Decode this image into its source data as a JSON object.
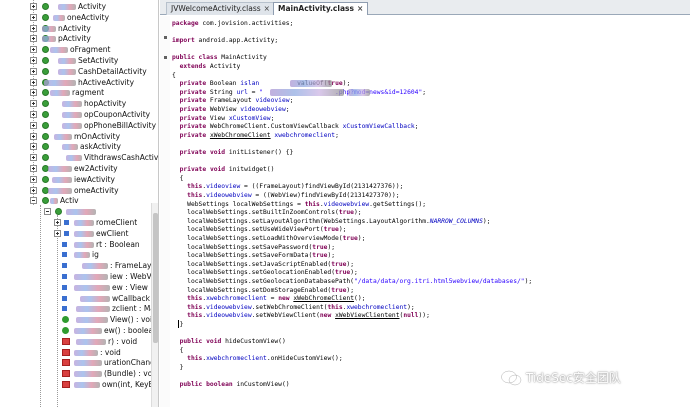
{
  "tree": {
    "items": [
      {
        "label": "Activity"
      },
      {
        "label": "oneActivity"
      },
      {
        "label": "nActivity"
      },
      {
        "label": "pActivity"
      },
      {
        "label": "oFragment"
      },
      {
        "label": "SetActivity"
      },
      {
        "label": "CashDetailActivity"
      },
      {
        "label": "hActiveActivity"
      },
      {
        "label": "ragment"
      },
      {
        "label": "hopActivity"
      },
      {
        "label": "opCouponActivity"
      },
      {
        "label": "opPhoneBillActivity"
      },
      {
        "label": "mOnActivity"
      },
      {
        "label": "askActivity"
      },
      {
        "label": "VithdrawsCashActivity"
      },
      {
        "label": "ew2Activity"
      },
      {
        "label": "iewActivity"
      },
      {
        "label": "omeActivity"
      },
      {
        "label": "Activ"
      }
    ],
    "members": [
      {
        "label": ""
      },
      {
        "label": "romeClient"
      },
      {
        "label": "ewClient"
      },
      {
        "label": "rt : Boolean"
      },
      {
        "label": "ig"
      },
      {
        "label": ": FrameLayout"
      },
      {
        "label": "iew : WebView"
      },
      {
        "label": "ew : View"
      },
      {
        "label": "wCallback : \\"
      },
      {
        "label": "zclient : Mair"
      },
      {
        "label": "View() : void"
      },
      {
        "label": "ew() : boolea"
      },
      {
        "label": "r) : void"
      },
      {
        "label": ": void"
      },
      {
        "label": "urationChange("
      },
      {
        "label": "(Bundle) : void"
      },
      {
        "label": "own(int, KeyEven"
      }
    ]
  },
  "tabs": [
    {
      "label": "JVWelcomeActivity.class",
      "active": false
    },
    {
      "label": "MainActivity.class",
      "active": true
    }
  ],
  "code": {
    "lines": [
      "package com.jovision.activities;",
      "",
      "import android.app.Activity;",
      "",
      "public class MainActivity",
      "  extends Activity",
      "{",
      "  private Boolean islan          valueOf(true);",
      "  private String url = \"                   .php?mod=news&id=12604\";",
      "  private FrameLayout videoview;",
      "  private WebView videowebview;",
      "  private View xCustomView;",
      "  private WebChromeClient.CustomViewCallback xCustomViewCallback;",
      "  private xWebChromeClient xwebchromeclient;",
      "",
      "  private void initListener() {}",
      "",
      "  private void initwidget()",
      "  {",
      "    this.videoview = ((FrameLayout)findViewById(2131427376));",
      "    this.videowebview = ((WebView)findViewById(2131427370));",
      "    WebSettings localWebSettings = this.videowebview.getSettings();",
      "    localWebSettings.setBuiltInZoomControls(true);",
      "    localWebSettings.setLayoutAlgorithm(WebSettings.LayoutAlgorithm.NARROW_COLUMNS);",
      "    localWebSettings.setUseWideViewPort(true);",
      "    localWebSettings.setLoadWithOverviewMode(true);",
      "    localWebSettings.setSavePassword(true);",
      "    localWebSettings.setSaveFormData(true);",
      "    localWebSettings.setJavaScriptEnabled(true);",
      "    localWebSettings.setGeolocationEnabled(true);",
      "    localWebSettings.setGeolocationDatabasePath(\"/data/data/org.itri.html5webview/databases/\");",
      "    localWebSettings.setDomStorageEnabled(true);",
      "    this.xwebchromeclient = new xWebChromeClient();",
      "    this.videowebview.setWebChromeClient(this.xwebchromeclient);",
      "    this.videowebview.setWebViewClient(new xWebViewClientent(null));",
      "  }",
      "",
      "  public void hideCustomView()",
      "  {",
      "    this.xwebchromeclient.onHideCustomView();",
      "  }",
      "",
      "  public boolean inCustomView()"
    ]
  },
  "watermark": {
    "text": "TideSec安全团队",
    "icon": "wechat-icon"
  }
}
